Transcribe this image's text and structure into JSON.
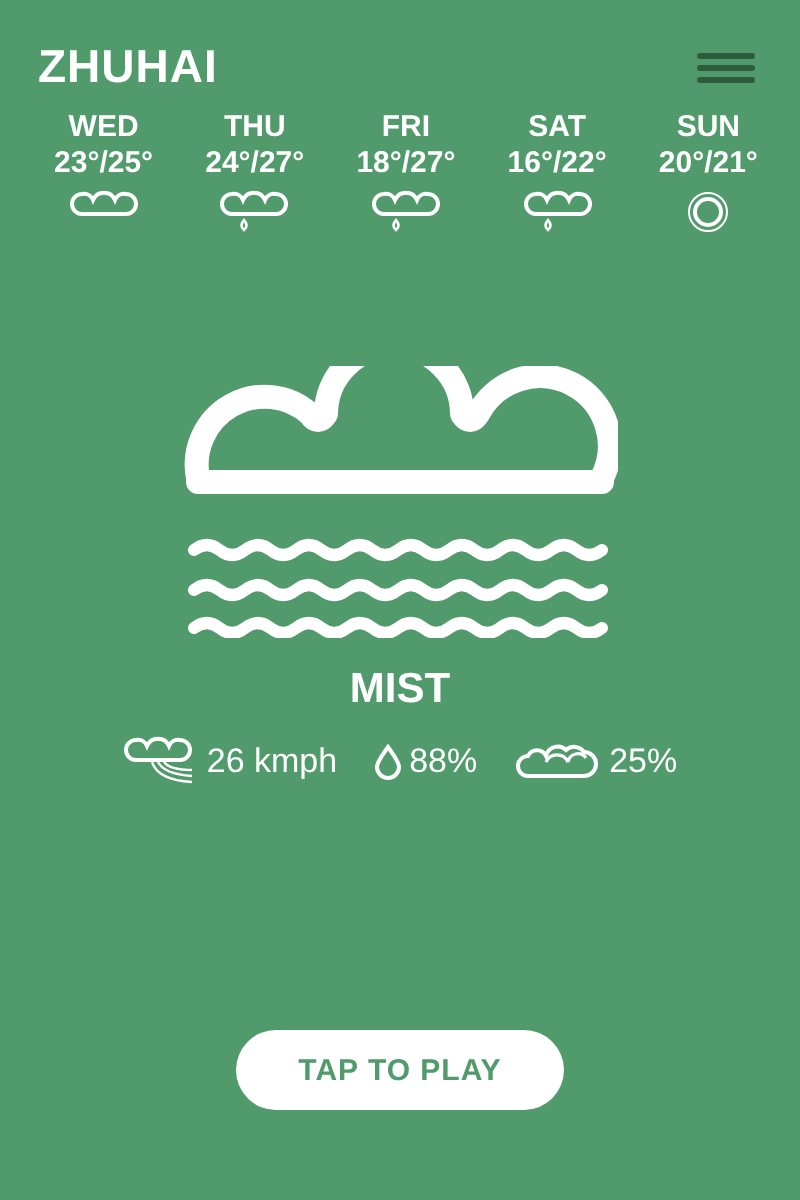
{
  "city": "ZHUHAI",
  "forecast": [
    {
      "day": "WED",
      "temps": "23°/25°",
      "kind": "cloud"
    },
    {
      "day": "THU",
      "temps": "24°/27°",
      "kind": "rain"
    },
    {
      "day": "FRI",
      "temps": "18°/27°",
      "kind": "rain"
    },
    {
      "day": "SAT",
      "temps": "16°/22°",
      "kind": "rain"
    },
    {
      "day": "SUN",
      "temps": "20°/21°",
      "kind": "sun"
    }
  ],
  "current": {
    "kind": "mist",
    "condition": "MIST"
  },
  "stats": [
    {
      "kind": "wind",
      "value": "26 kmph"
    },
    {
      "kind": "humidity",
      "value": "88%"
    },
    {
      "kind": "cloud",
      "value": "25%"
    }
  ],
  "play_button": "TAP TO PLAY"
}
